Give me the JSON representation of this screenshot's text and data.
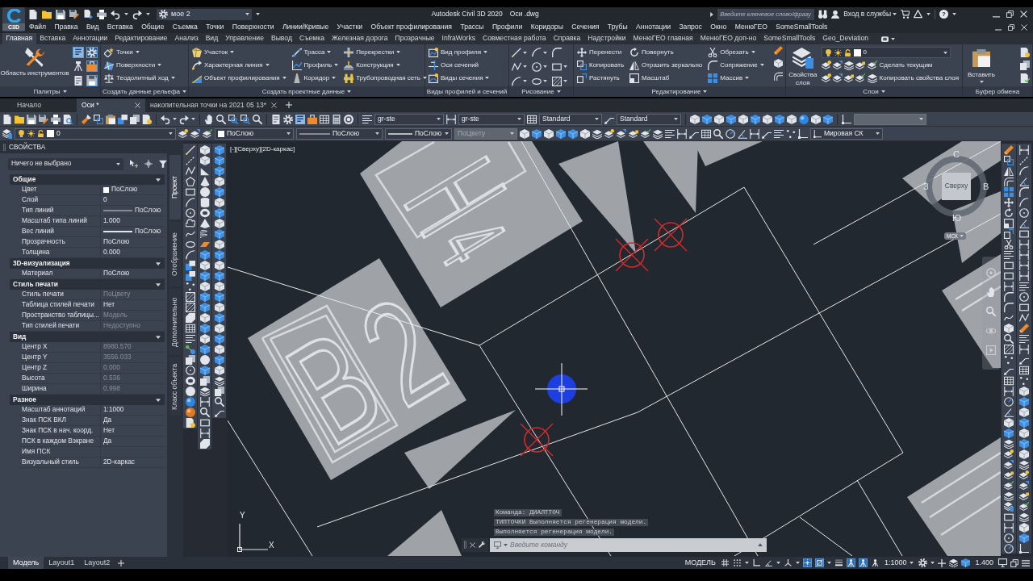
{
  "title_bar": {
    "app_badge": "C3D",
    "workspace": "мое 2",
    "app_name": "Autodesk Civil 3D 2020",
    "document": "Оси .dwg",
    "search": {
      "placeholder": "Введите ключевое слово/фразу"
    },
    "sign_in": "Вход в службы",
    "help": "?"
  },
  "menu_bar": [
    "Файл",
    "Правка",
    "Вид",
    "Вставка",
    "Общие",
    "Съемка",
    "Точки",
    "Поверхности",
    "Линии/Кривые",
    "Участки",
    "Объект профилирования",
    "Трассы",
    "Профили",
    "Коридоры",
    "Сечения",
    "Трубы",
    "Аннотации",
    "Запрос",
    "Окно",
    "МенюГЕО",
    "SomeSmallTools"
  ],
  "ribbon_tabs": [
    {
      "label": "Главная",
      "selected": true
    },
    {
      "label": "Вставка",
      "selected": false
    },
    {
      "label": "Аннотации",
      "selected": false
    },
    {
      "label": "Редактирование",
      "selected": false
    },
    {
      "label": "Анализ",
      "selected": false
    },
    {
      "label": "Вид",
      "selected": false
    },
    {
      "label": "Управление",
      "selected": false
    },
    {
      "label": "Вывод",
      "selected": false
    },
    {
      "label": "Съемка",
      "selected": false
    },
    {
      "label": "Железная дорога",
      "selected": false
    },
    {
      "label": "Прозрачные",
      "selected": false
    },
    {
      "label": "InfraWorks",
      "selected": false
    },
    {
      "label": "Совместная работа",
      "selected": false
    },
    {
      "label": "Справка",
      "selected": false
    },
    {
      "label": "Надстройки",
      "selected": false
    },
    {
      "label": "МенюГЕО главная",
      "selected": false
    },
    {
      "label": "МенюГЕО доп-но",
      "selected": false
    },
    {
      "label": "SomeSmallTools",
      "selected": false
    },
    {
      "label": "Geo_Deviation",
      "selected": false
    }
  ],
  "ribbon_panels": [
    {
      "kind": "palettes",
      "title": "Палитры",
      "menu": true,
      "big_button": "Область инструментов",
      "toggles": [
        {
          "on": true
        },
        {
          "on": true
        },
        {
          "on": false
        },
        {
          "on": true
        },
        {
          "on": false
        },
        {
          "on": true
        }
      ]
    },
    {
      "kind": "commands",
      "title": "Создать данные рельефа",
      "menu": true,
      "columns": [
        [
          {
            "label": "Точки",
            "dropdown": true
          },
          {
            "label": "Поверхности",
            "dropdown": true
          },
          {
            "label": "Теодолитный ход",
            "dropdown": true
          }
        ]
      ]
    },
    {
      "kind": "commands",
      "title": "Создать проектные данные",
      "menu": true,
      "columns": [
        [
          {
            "label": "Участок",
            "dropdown": true
          },
          {
            "label": "Характерная линия",
            "dropdown": true
          },
          {
            "label": "Объект профилирования",
            "dropdown": true
          }
        ],
        [
          {
            "label": "Трасса",
            "dropdown": true
          },
          {
            "label": "Профиль",
            "dropdown": true
          },
          {
            "label": "Коридор",
            "dropdown": true
          }
        ],
        [
          {
            "label": "Перекрестки",
            "dropdown": true
          },
          {
            "label": "Конструкция",
            "dropdown": true
          },
          {
            "label": "Трубопроводная сеть",
            "dropdown": true
          }
        ]
      ]
    },
    {
      "kind": "commands",
      "title": "Виды профилей и сечений",
      "menu": false,
      "columns": [
        [
          {
            "label": "Вид профиля",
            "dropdown": true
          },
          {
            "label": "Оси сечений",
            "dropdown": false
          },
          {
            "label": "Виды сечения",
            "dropdown": true
          }
        ]
      ]
    },
    {
      "kind": "drawing",
      "title": "Рисование",
      "menu": true
    },
    {
      "kind": "modify",
      "title": "Редактирование",
      "menu": true,
      "columns": [
        [
          {
            "label": "Перенести",
            "dropdown": false
          },
          {
            "label": "Копировать",
            "dropdown": false
          },
          {
            "label": "Растянуть",
            "dropdown": false
          }
        ],
        [
          {
            "label": "Повернуть",
            "dropdown": false
          },
          {
            "label": "Отразить зеркально",
            "dropdown": false
          },
          {
            "label": "Масштаб",
            "dropdown": false
          }
        ],
        [
          {
            "label": "Обрезать",
            "dropdown": true
          },
          {
            "label": "Сопряжение",
            "dropdown": true
          },
          {
            "label": "Массив",
            "dropdown": true
          }
        ]
      ]
    },
    {
      "kind": "layers",
      "title": "Слои",
      "menu": true,
      "big_button": "Свойства слоя",
      "layer": "0",
      "actions": [
        "Сделать текущим",
        "Копировать свойства слоя"
      ]
    },
    {
      "kind": "clipboard",
      "title": "Буфер обмена",
      "menu": false,
      "big_button": "Вставить"
    }
  ],
  "file_tabs": [
    {
      "label": "Начало",
      "selected": false,
      "closable": false
    },
    {
      "label": "Оси *",
      "selected": true,
      "closable": true
    },
    {
      "label": "накопительная точки на 2021 05 13*",
      "selected": false,
      "closable": true
    }
  ],
  "toolbar_1": {
    "dropdowns": [
      {
        "value": "gr-ste",
        "disabled": false
      },
      {
        "value": "gr-ste",
        "disabled": false
      },
      {
        "value": "Standard",
        "disabled": false
      },
      {
        "value": "Standard",
        "disabled": false
      },
      {
        "disabled": true
      }
    ]
  },
  "toolbar_2": {
    "dropdowns": [
      {
        "kind": "layer",
        "value": "0",
        "disabled": false
      },
      {
        "kind": "color",
        "value": "ПоСлою",
        "disabled": false
      },
      {
        "kind": "linetype",
        "value": "ПоСлою",
        "disabled": false
      },
      {
        "kind": "lineweight",
        "value": "ПоСлою",
        "disabled": false
      },
      {
        "kind": "plain",
        "value": "ПоЦвету",
        "disabled": true
      },
      {
        "kind": "ucs",
        "value": "Мировая СК",
        "disabled": false
      }
    ]
  },
  "properties": {
    "title": "СВОЙСТВА",
    "selection": "Ничего не выбрано",
    "sections": [
      {
        "name": "Общие",
        "expanded": true,
        "rows": [
          {
            "label": "Цвет",
            "value": "ПоСлою",
            "kind": "color",
            "disabled": false
          },
          {
            "label": "Слой",
            "value": "0",
            "kind": "text",
            "disabled": false
          },
          {
            "label": "Тип линий",
            "value": "ПоСлою",
            "kind": "linetype",
            "disabled": false
          },
          {
            "label": "Масштаб типа линий",
            "value": "1.000",
            "kind": "text",
            "disabled": false
          },
          {
            "label": "Вес линий",
            "value": "ПоСлою",
            "kind": "lineweight",
            "disabled": false
          },
          {
            "label": "Прозрачность",
            "value": "ПоСлою",
            "kind": "text",
            "disabled": false
          },
          {
            "label": "Толщина",
            "value": "0.000",
            "kind": "text",
            "disabled": false
          }
        ]
      },
      {
        "name": "3D-визуализация",
        "expanded": true,
        "rows": [
          {
            "label": "Материал",
            "value": "ПоСлою",
            "kind": "text",
            "disabled": false
          }
        ]
      },
      {
        "name": "Стиль печати",
        "expanded": true,
        "rows": [
          {
            "label": "Стиль печати",
            "value": "ПоЦвету",
            "kind": "text",
            "disabled": true
          },
          {
            "label": "Таблица стилей печати",
            "value": "Нет",
            "kind": "text",
            "disabled": false
          },
          {
            "label": "Пространство таблицы...",
            "value": "Модель",
            "kind": "text",
            "disabled": true
          },
          {
            "label": "Тип стилей печати",
            "value": "Недоступно",
            "kind": "text",
            "disabled": true
          }
        ]
      },
      {
        "name": "Вид",
        "expanded": true,
        "rows": [
          {
            "label": "Центр X",
            "value": "8980.570",
            "kind": "text",
            "disabled": true
          },
          {
            "label": "Центр Y",
            "value": "3556.033",
            "kind": "text",
            "disabled": true
          },
          {
            "label": "Центр Z",
            "value": "0.000",
            "kind": "text",
            "disabled": true
          },
          {
            "label": "Высота",
            "value": "0.536",
            "kind": "text",
            "disabled": true
          },
          {
            "label": "Ширина",
            "value": "0.998",
            "kind": "text",
            "disabled": true
          }
        ]
      },
      {
        "name": "Разное",
        "expanded": true,
        "rows": [
          {
            "label": "Масштаб аннотаций",
            "value": "1:1000",
            "kind": "text",
            "disabled": false
          },
          {
            "label": "Знак ПСК ВКЛ",
            "value": "Да",
            "kind": "text",
            "disabled": false
          },
          {
            "label": "Знак ПСК в нач. коорд.",
            "value": "Нет",
            "kind": "text",
            "disabled": false
          },
          {
            "label": "ПСК в каждом Вэкране",
            "value": "Да",
            "kind": "text",
            "disabled": false
          },
          {
            "label": "Имя ПСК"
          },
          {
            "label": "Визуальный стиль",
            "value": "2D-каркас",
            "kind": "text",
            "disabled": false
          }
        ]
      }
    ]
  },
  "palette_tabs": [
    {
      "label": "Проект",
      "selected": true
    },
    {
      "label": "Отображение",
      "selected": false
    },
    {
      "label": "Дополнительно",
      "selected": false
    },
    {
      "label": "Класс объекта",
      "selected": false
    }
  ],
  "viewport": {
    "label": "[-][Сверху][2D-каркас]",
    "drawing_labels": [
      "H",
      "4",
      "B",
      "2"
    ],
    "viewcube": {
      "face": "Сверху",
      "north": "С",
      "east": "В",
      "south": "Ю",
      "west": "З",
      "ucs": "МСК"
    },
    "ucs_icon": {
      "x": "X",
      "y": "Y"
    }
  },
  "command_line": {
    "history": [
      "Команда: ДИАЛТТОЧ",
      "ТИПТОЧКИ Выполняется регенерация модели.",
      "Выполняется регенерация модели."
    ],
    "placeholder": "Введите команду"
  },
  "layout_tabs": [
    {
      "label": "Модель",
      "selected": true
    },
    {
      "label": "Layout1",
      "selected": false
    },
    {
      "label": "Layout2",
      "selected": false
    }
  ],
  "status_bar": {
    "space": "МОДЕЛЬ",
    "annotation_scale": "1:1000",
    "value": "1.400",
    "toggles": [
      {
        "on": false
      },
      {
        "on": false
      },
      {
        "on": false
      },
      {
        "on": false
      },
      {
        "on": false
      },
      {
        "on": true
      },
      {
        "on": true
      },
      {
        "on": false
      },
      {
        "on": true
      },
      {
        "on": true
      },
      {
        "on": false
      }
    ]
  }
}
